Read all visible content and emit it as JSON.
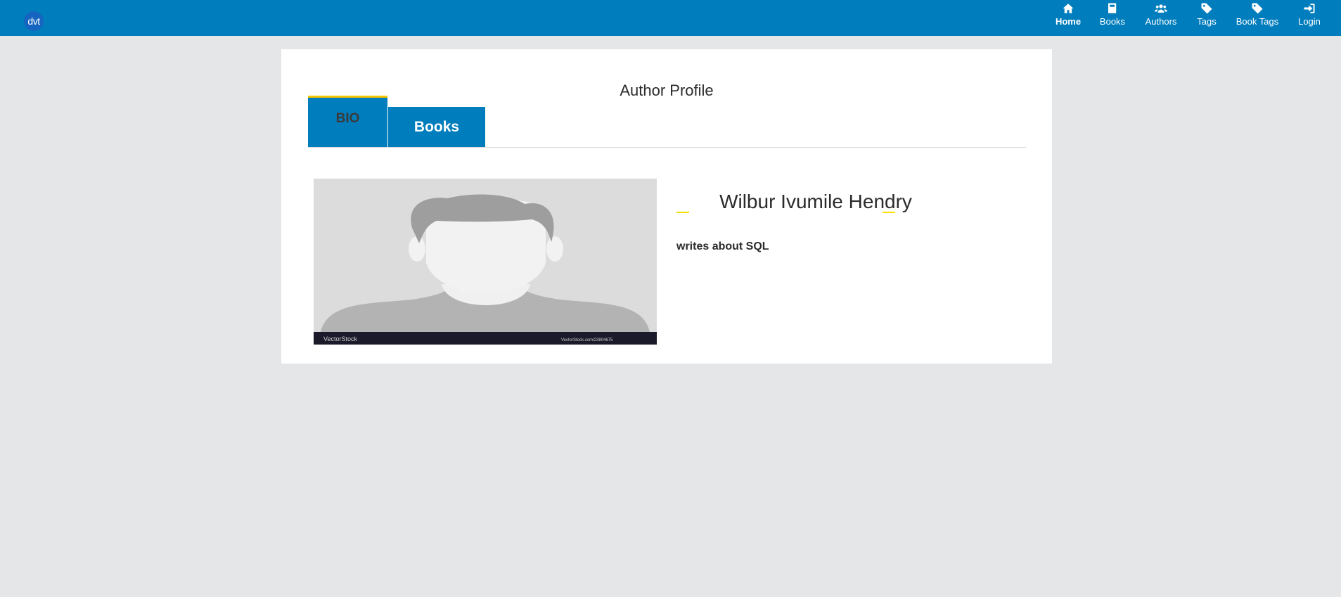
{
  "navbar": {
    "logo_text": "dvt",
    "items": [
      {
        "label": "Home",
        "icon": "home-icon"
      },
      {
        "label": "Books",
        "icon": "book-icon"
      },
      {
        "label": "Authors",
        "icon": "users-icon"
      },
      {
        "label": "Tags",
        "icon": "tag-icon"
      },
      {
        "label": "Book Tags",
        "icon": "tag-icon"
      },
      {
        "label": "Login",
        "icon": "login-icon"
      }
    ],
    "active": "Home"
  },
  "page": {
    "title": "Author Profile",
    "tabs": [
      {
        "label": "BIO",
        "active": true
      },
      {
        "label": "Books",
        "active": false
      }
    ]
  },
  "author": {
    "name": "Wilbur Ivumile Hendry",
    "tagline": "writes about SQL",
    "portrait_watermark_left": "VectorStock",
    "portrait_watermark_right": "VectorStock.com/23804675"
  },
  "colors": {
    "navbar": "#007dbc",
    "background": "#e5e6e8",
    "card": "#ffffff",
    "tab": "#007dbc",
    "active_tab_accent": "#f5c400",
    "name_dash": "#f5e000"
  }
}
